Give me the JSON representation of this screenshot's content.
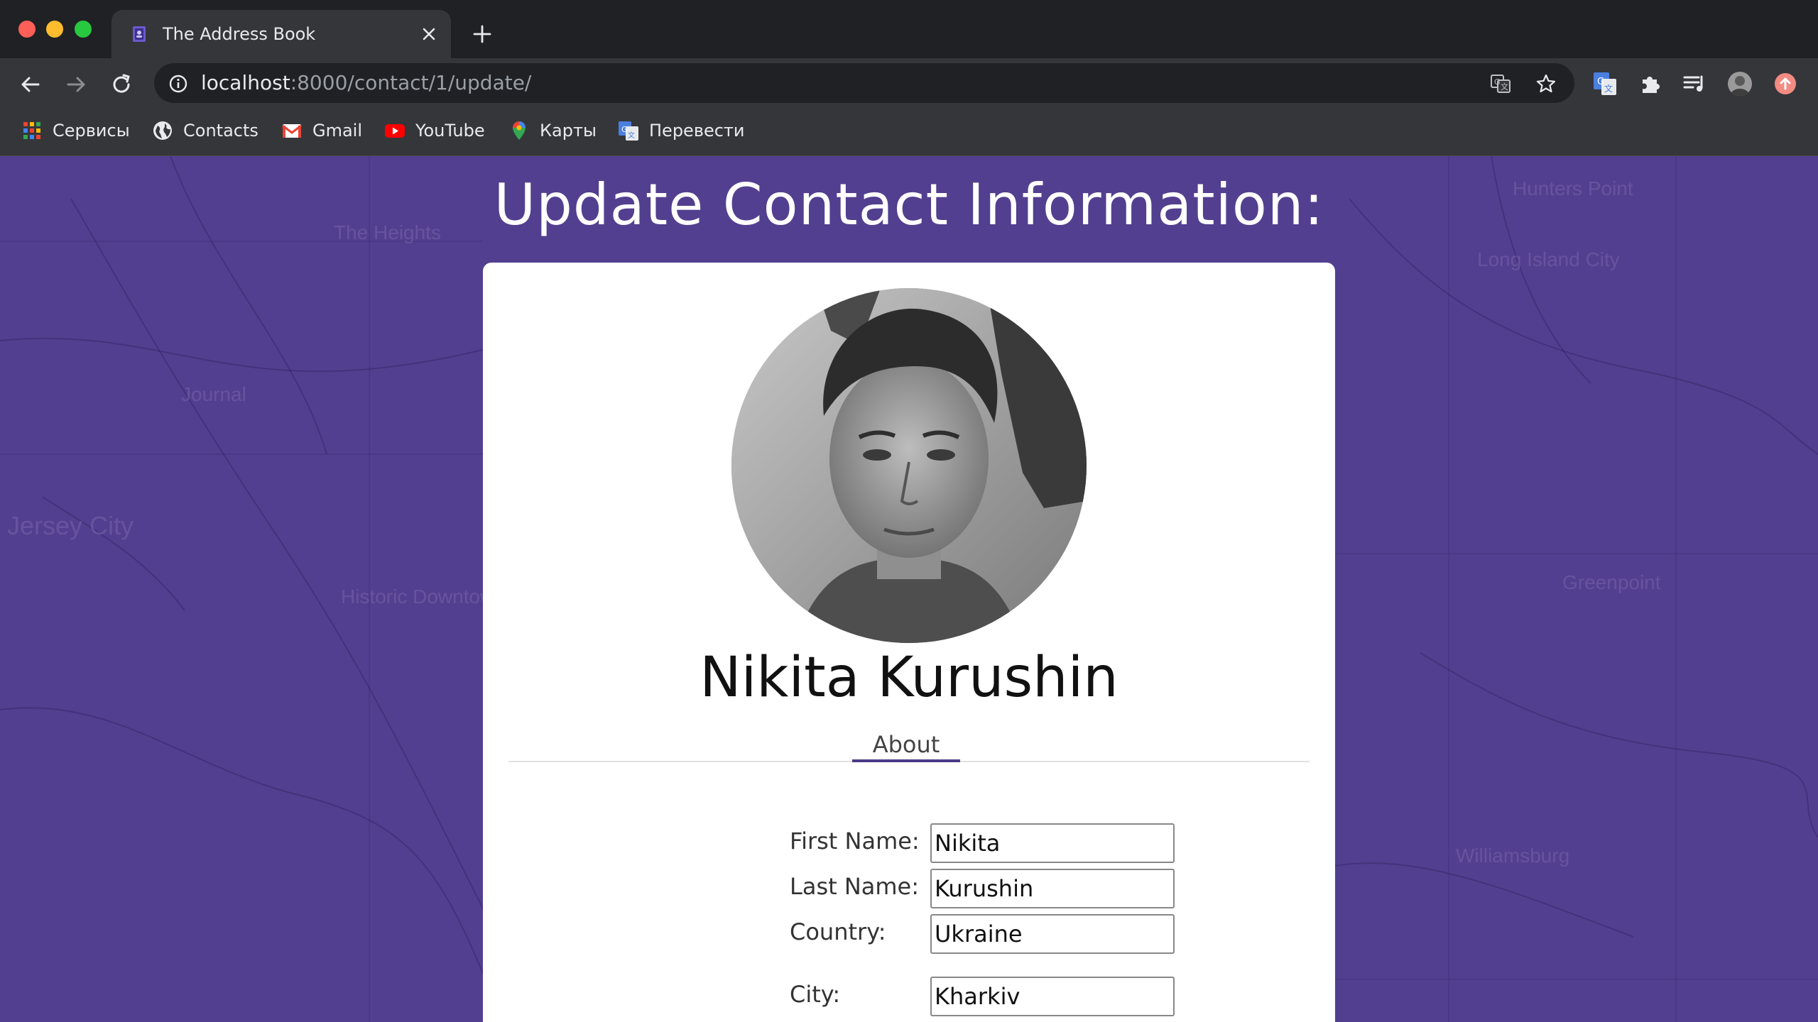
{
  "browser": {
    "tab_title": "The Address Book",
    "url_host": "localhost",
    "url_rest": ":8000/contact/1/update/",
    "bookmarks": [
      {
        "label": "Сервисы",
        "icon": "apps-grid-icon"
      },
      {
        "label": "Contacts",
        "icon": "globe-icon"
      },
      {
        "label": "Gmail",
        "icon": "gmail-icon"
      },
      {
        "label": "YouTube",
        "icon": "youtube-icon"
      },
      {
        "label": "Карты",
        "icon": "maps-pin-icon"
      },
      {
        "label": "Перевести",
        "icon": "translate-icon"
      }
    ]
  },
  "page": {
    "title": "Update Contact Information:",
    "contact": {
      "full_name": "Nikita Kurushin",
      "tab_label": "About"
    },
    "form": {
      "first_name_label": "First Name:",
      "first_name_value": "Nikita",
      "last_name_label": "Last Name:",
      "last_name_value": "Kurushin",
      "country_label": "Country:",
      "country_value": "Ukraine",
      "city_label": "City:",
      "city_value": "Kharkiv"
    }
  },
  "colors": {
    "page_background": "#533f8f",
    "accent": "#4b3a86",
    "chrome_dark": "#202124",
    "chrome_toolbar": "#35363a"
  }
}
